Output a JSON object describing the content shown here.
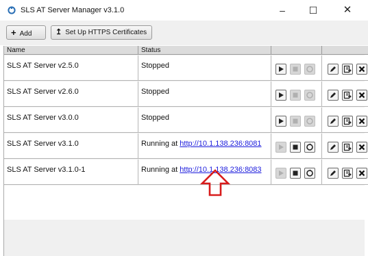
{
  "window": {
    "title": "SLS AT Server Manager v3.1.0",
    "icon": "app-logo-icon",
    "controls": {
      "minimize": "–",
      "maximize": "☐",
      "close": "✕"
    }
  },
  "toolbar": {
    "add_label": "Add",
    "add_icon": "plus-icon",
    "https_label": "Set Up HTTPS Certificates",
    "https_icon": "certificate-icon"
  },
  "table": {
    "columns": {
      "name": "Name",
      "status": "Status"
    },
    "rows": [
      {
        "name": "SLS AT Server v2.5.0",
        "status": "Stopped",
        "status_link": "",
        "running": false
      },
      {
        "name": "SLS AT Server v2.6.0",
        "status": "Stopped",
        "status_link": "",
        "running": false
      },
      {
        "name": "SLS AT Server v3.0.0",
        "status": "Stopped",
        "status_link": "",
        "running": false
      },
      {
        "name": "SLS AT Server v3.1.0",
        "status": "Running at ",
        "status_link": "http://10.1.138.236:8081",
        "running": true
      },
      {
        "name": "SLS AT Server v3.1.0-1",
        "status": "Running at ",
        "status_link": "http://10.1.138.236:8083",
        "running": true
      }
    ]
  },
  "annotation": {
    "shape": "arrow-up-icon",
    "color": "#d81b1b"
  }
}
